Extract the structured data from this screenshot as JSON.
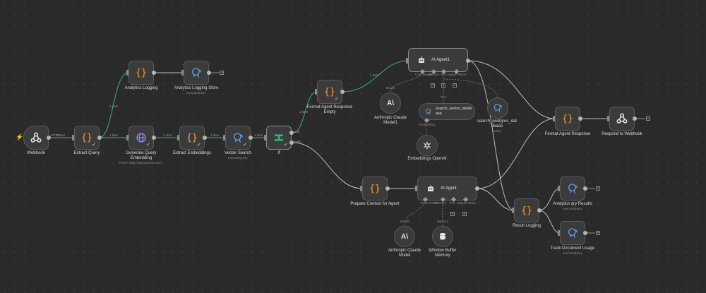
{
  "nodes": {
    "webhook": {
      "label": "Webhook"
    },
    "extract_query": {
      "label": "Extract Query"
    },
    "analytics_logging": {
      "label": "Analytics Logging"
    },
    "analytics_logging_store": {
      "label": "Analytics Logging Store",
      "sub": "executeQuery"
    },
    "generate_query_embedding": {
      "label": "Generate Query\nEmbedding",
      "sub": "POST: https://api.openai.com/..."
    },
    "extract_embeddings": {
      "label": "Extract Embeddings"
    },
    "vector_search": {
      "label": "Vector Search",
      "sub": "executeQuery"
    },
    "if": {
      "label": "If",
      "out_true": "true",
      "out_false": "false"
    },
    "format_agent_response_empty": {
      "label": "Format Agent Response\nEmpty"
    },
    "ai_agent1": {
      "label": "AI Agent1",
      "ports": [
        "Chat Model*",
        "Memory",
        "Tool",
        "Output Parser"
      ]
    },
    "anthropic_claude_model1": {
      "label": "Anthropic Claude\nModel1",
      "port": "Model"
    },
    "search_sector_database": {
      "label": "search_sector_datab\nase",
      "port": "Tool"
    },
    "embeddings_openai": {
      "label": "Embeddings OpenAI",
      "port": "Embedding"
    },
    "search_postgres_database": {
      "label": "search_postgres_dat\nabase",
      "sub": "select"
    },
    "format_agent_response": {
      "label": "Format Agent Response"
    },
    "respond_to_webhook": {
      "label": "Respond to Webhook"
    },
    "prepare_context": {
      "label": "Prepare Context for Agent"
    },
    "ai_agent": {
      "label": "AI Agent",
      "ports": [
        "Chat Model*",
        "Memory",
        "Tool",
        "Output Parser"
      ]
    },
    "anthropic_claude_model": {
      "label": "Anthropic Claude\nModel",
      "port": "Model"
    },
    "window_buffer_memory": {
      "label": "Window Buffer\nMemory",
      "port": "Memory"
    },
    "result_logging": {
      "label": "Result Logging"
    },
    "analytics_qry_results": {
      "label": "Analytics qry Results",
      "sub": "executeQuery"
    },
    "track_document_usage": {
      "label": "Track Document Usage",
      "sub": "executeQuery"
    }
  },
  "edge_labels": {
    "webhook_out": "POST",
    "item": "1 item"
  },
  "colors": {
    "background": "#2a2a2a",
    "node": "#3b3b3b",
    "success_edge": "#3fae6f",
    "default_edge": "#8a8a8a",
    "code_icon": "#ff9d2f",
    "db_icon": "#5e9fdd",
    "if_icon": "#35b36e",
    "trigger_bolt": "#ff6d4d"
  },
  "icons": {
    "webhook": "webhook-icon",
    "code": "code-braces-icon",
    "http": "globe-icon",
    "postgres": "postgres-elephant-icon",
    "if": "if-branch-icon",
    "agent": "robot-icon",
    "anthropic": "anthropic-icon",
    "openai": "openai-icon",
    "memory": "database-stack-icon",
    "respond": "webhook-icon"
  }
}
